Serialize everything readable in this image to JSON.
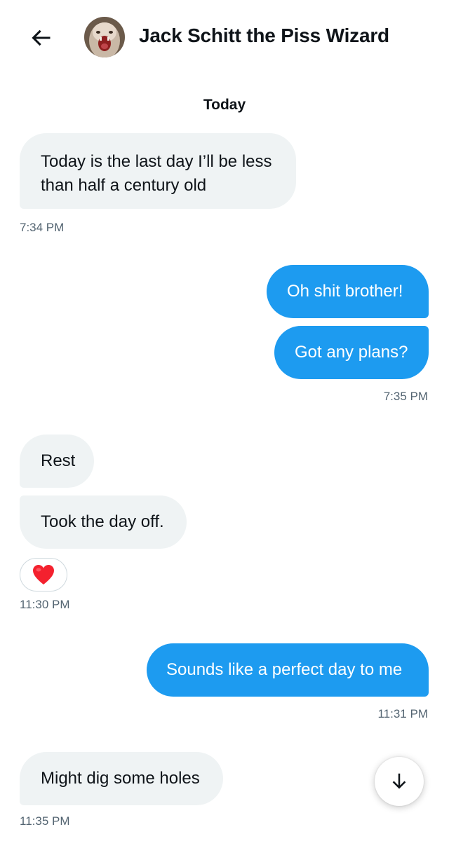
{
  "header": {
    "back_icon": "arrow-left-icon",
    "title": "Jack Schitt the Piss Wizard"
  },
  "date_divider": "Today",
  "messages": [
    {
      "direction": "incoming",
      "lines": [
        "Today is the last day I’ll be less",
        "than half a century old"
      ]
    },
    {
      "direction": "outgoing",
      "text": "Oh shit brother!"
    },
    {
      "direction": "outgoing",
      "text": "Got any plans?"
    },
    {
      "direction": "incoming",
      "text": "Rest"
    },
    {
      "direction": "incoming",
      "text": "Took the day off."
    },
    {
      "direction": "outgoing",
      "text": "Sounds like a perfect day to me"
    },
    {
      "direction": "incoming",
      "text": "Might dig some holes"
    }
  ],
  "timestamps": [
    "7:34 PM",
    "7:35 PM",
    "11:30 PM",
    "11:31 PM",
    "11:35 PM"
  ],
  "reaction": {
    "icon": "heart-icon",
    "color": "#f4212e"
  },
  "scroll_button": {
    "icon": "arrow-down-icon"
  },
  "colors": {
    "outgoing_bubble": "#1d9bf0",
    "incoming_bubble": "#eff3f4",
    "timestamp": "#536471"
  }
}
